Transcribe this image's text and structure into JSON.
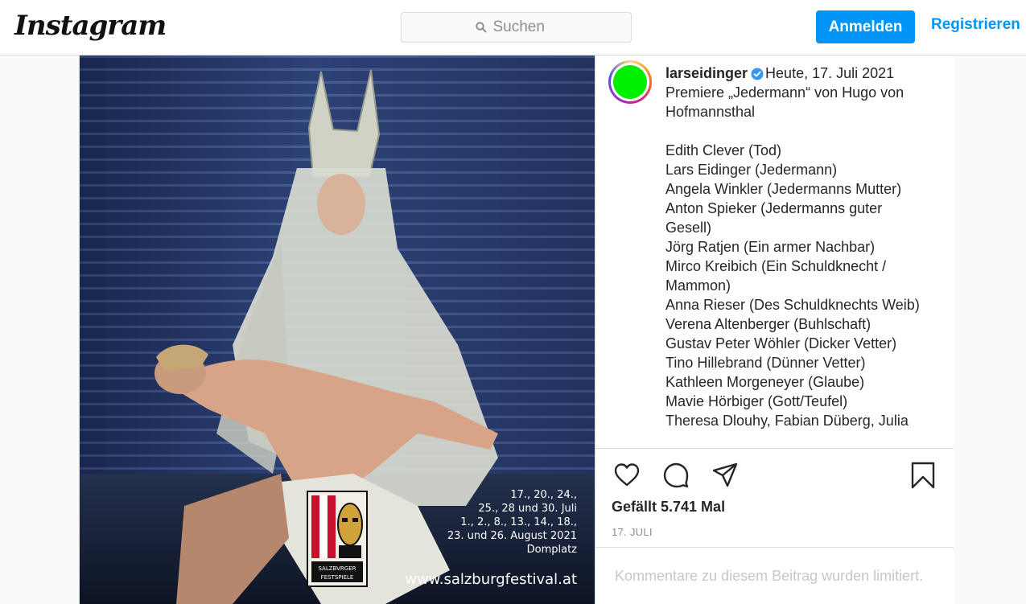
{
  "header": {
    "logo_text": "Instagram",
    "search_placeholder": "Suchen",
    "login_label": "Anmelden",
    "register_label": "Registrieren"
  },
  "post": {
    "username": "larseidinger",
    "verified": true,
    "timestamp": "Heute, 17. Juli 2021",
    "caption_title": "Premiere „Jedermann“ von Hugo von Hofmannsthal",
    "cast": [
      "Edith Clever (Tod)",
      "Lars Eidinger (Jedermann)",
      "Angela Winkler (Jedermanns Mutter)",
      "Anton Spieker (Jedermanns guter Gesell)",
      "Jörg Ratjen (Ein armer Nachbar)",
      "Mirco Kreibich (Ein Schuldknecht / Mammon)",
      "Anna Rieser (Des Schuldknechts Weib)",
      "Verena Altenberger (Buhlschaft)",
      "Gustav Peter Wöhler (Dicker Vetter)",
      "Tino Hillebrand (Dünner Vetter)",
      "Kathleen Morgeneyer (Glaube)",
      "Mavie Hörbiger (Gott/Teufel)",
      "Theresa Dlouhy, Fabian Düberg, Julia"
    ],
    "likes_text": "Gefällt 5.741 Mal",
    "date_label": "17. JULI",
    "comments_disabled_text": "Kommentare zu diesem Beitrag wurden limitiert.",
    "icons": [
      "heart-icon",
      "comment-icon",
      "share-icon",
      "bookmark-icon"
    ]
  },
  "poster": {
    "dates": [
      "17., 20., 24.,",
      "25., 28 und 30. Juli",
      "1., 2., 8., 13., 14., 18.,",
      "23. und 26. August 2021",
      "Domplatz"
    ],
    "url": "www.salzburgfestival.at",
    "logo_text": "SALZBVRGER FESTSPIELE"
  },
  "colors": {
    "accent": "#0095f6",
    "avatar": "#00ee00",
    "border": "#dbdbdb",
    "muted": "#8e8e8e"
  }
}
